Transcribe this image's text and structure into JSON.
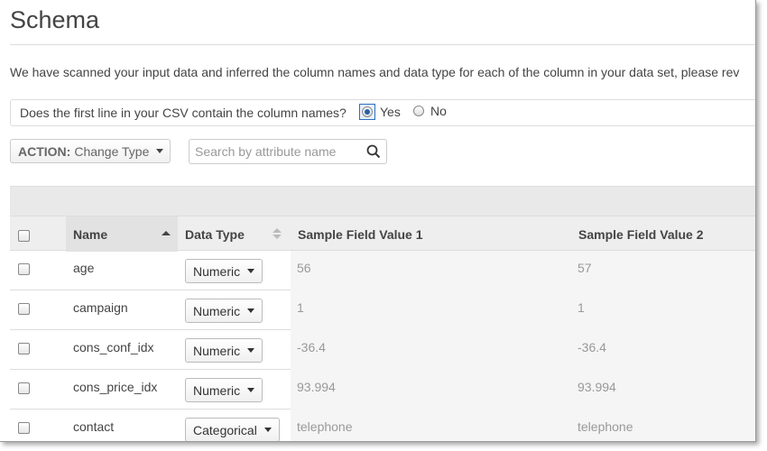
{
  "page": {
    "title": "Schema",
    "intro": "We have scanned your input data and inferred the column names and data type for each of the column in your data set, please rev"
  },
  "header_question": {
    "text": "Does the first line in your CSV contain the column names?",
    "yes_label": "Yes",
    "no_label": "No",
    "selected": "Yes"
  },
  "toolbar": {
    "action_prefix": "ACTION:",
    "action_value": "Change Type",
    "search_placeholder": "Search by attribute name"
  },
  "table": {
    "columns": {
      "name": "Name",
      "data_type": "Data Type",
      "sample1": "Sample Field Value 1",
      "sample2": "Sample Field Value 2"
    },
    "rows": [
      {
        "name": "age",
        "type": "Numeric",
        "sample1": "56",
        "sample2": "57"
      },
      {
        "name": "campaign",
        "type": "Numeric",
        "sample1": "1",
        "sample2": "1"
      },
      {
        "name": "cons_conf_idx",
        "type": "Numeric",
        "sample1": "-36.4",
        "sample2": "-36.4"
      },
      {
        "name": "cons_price_idx",
        "type": "Numeric",
        "sample1": "93.994",
        "sample2": "93.994"
      },
      {
        "name": "contact",
        "type": "Categorical",
        "sample1": "telephone",
        "sample2": "telephone"
      }
    ]
  },
  "icons": {
    "search": "search-icon",
    "caret": "chevron-down-icon",
    "sort": "sort-ascending-icon"
  },
  "colors": {
    "accent": "#2a5fa8",
    "header_bg": "#eeeeee",
    "sample_bg": "#f5f5f5"
  }
}
